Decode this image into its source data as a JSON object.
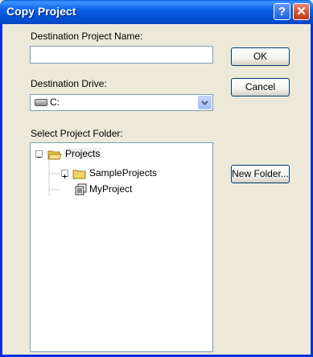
{
  "window": {
    "title": "Copy Project",
    "help_glyph": "?",
    "close_glyph": "✕"
  },
  "form": {
    "dest_name_label": "Destination Project Name:",
    "dest_name_value": "",
    "dest_drive_label": "Destination Drive:",
    "dest_drive_value": "C:",
    "folder_label": "Select Project Folder:"
  },
  "buttons": {
    "ok": "OK",
    "cancel": "Cancel",
    "new_folder": "New Folder..."
  },
  "tree": {
    "root": {
      "label": "Projects",
      "expanded": true,
      "selected": true
    },
    "children": [
      {
        "label": "SampleProjects",
        "type": "folder",
        "expandable": true
      },
      {
        "label": "MyProject",
        "type": "project",
        "expandable": false
      }
    ]
  },
  "icons": {
    "drive": "drive-icon",
    "folder_open": "folder-open-icon",
    "folder": "folder-icon",
    "project": "project-icon"
  }
}
